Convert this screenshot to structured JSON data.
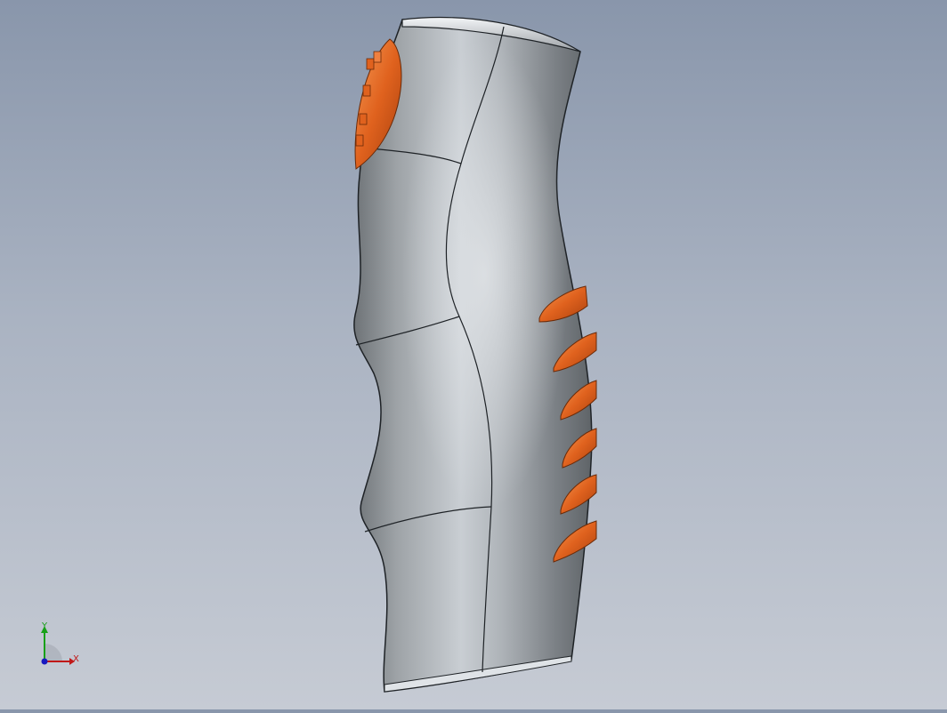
{
  "viewport": {
    "background_top": "#8996ab",
    "background_bottom": "#c6cbd4"
  },
  "model": {
    "name": "grip handle",
    "body_color": "#8c9094",
    "accent_color": "#e0621e",
    "edge_color": "#1e2226",
    "grip_ridges_count": 6
  },
  "triad": {
    "x_label": "X",
    "y_label": "Y",
    "x_color": "#c01818",
    "y_color": "#18a018",
    "z_color": "#1818c0"
  }
}
